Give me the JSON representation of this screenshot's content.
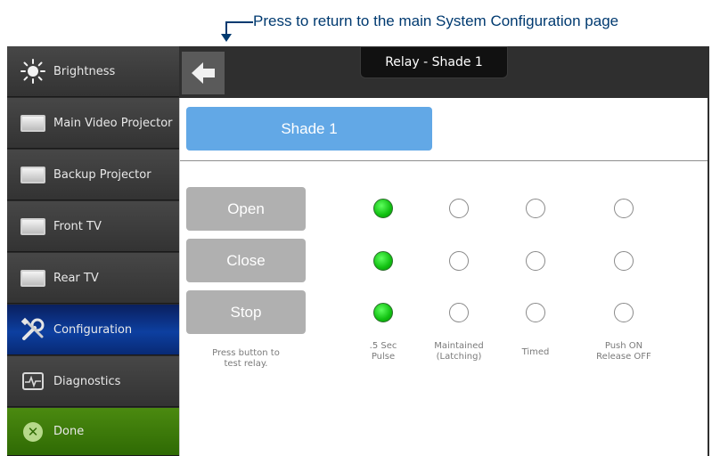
{
  "annotation": {
    "text": "Press to return to the main System Configuration page"
  },
  "sidebar": {
    "items": [
      {
        "label": "Brightness",
        "icon": "brightness-icon"
      },
      {
        "label": "Main Video Projector",
        "icon": "display-icon"
      },
      {
        "label": "Backup Projector",
        "icon": "display-icon"
      },
      {
        "label": "Front TV",
        "icon": "display-icon"
      },
      {
        "label": "Rear TV",
        "icon": "display-icon"
      },
      {
        "label": "Configuration",
        "icon": "tools-icon",
        "active": true
      },
      {
        "label": "Diagnostics",
        "icon": "diagnostics-icon"
      },
      {
        "label": "Done",
        "icon": "close-icon"
      }
    ]
  },
  "header": {
    "title": "Relay - Shade 1",
    "back_icon": "back-arrow-icon"
  },
  "main": {
    "device_name": "Shade 1",
    "relays": [
      {
        "label": "Open",
        "selected_mode": 0
      },
      {
        "label": "Close",
        "selected_mode": 0
      },
      {
        "label": "Stop",
        "selected_mode": 0
      }
    ],
    "hint": "Press button to\ntest relay.",
    "modes": [
      ".5 Sec\nPulse",
      "Maintained\n(Latching)",
      "Timed",
      "Push ON\nRelease OFF"
    ]
  },
  "colors": {
    "accent_blue": "#62a8e6",
    "active_nav": "#0d3fa0",
    "done_green": "#3f7d0a",
    "radio_on": "#11c011"
  }
}
